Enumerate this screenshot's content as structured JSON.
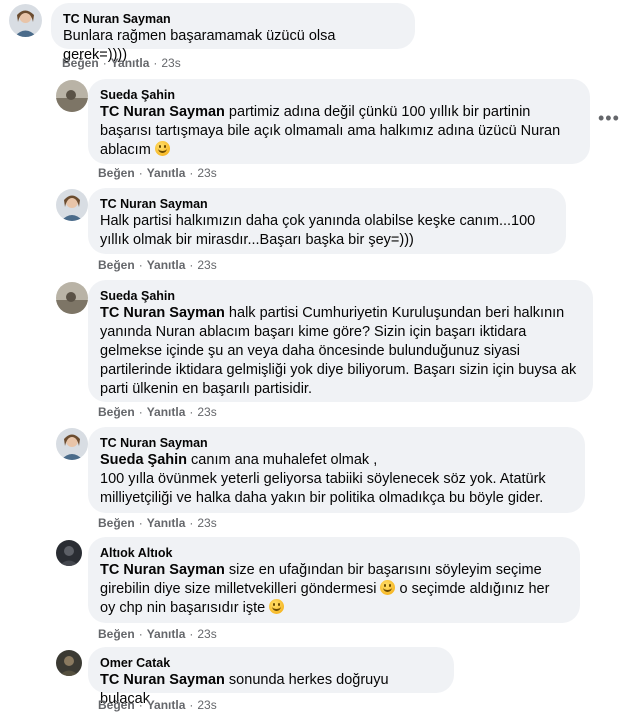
{
  "actions": {
    "like": "Beğen",
    "reply": "Yanıtla",
    "time": "23s",
    "sep": "·"
  },
  "comments": [
    {
      "author": "TC Nuran Sayman",
      "mention": "",
      "text": "Bunlara rağmen başaramamak üzücü olsa gerek=))))",
      "emoji": ""
    },
    {
      "author": "Sueda Şahin",
      "mention": "TC Nuran Sayman",
      "text": " partimiz adına değil çünkü 100 yıllık bir partinin başarısı tartışmaya bile açık olmamalı ama halkımız adına üzücü Nuran ablacım ",
      "emoji": "smile"
    },
    {
      "author": "TC Nuran Sayman",
      "mention": "",
      "text": "Halk partisi halkımızın daha çok yanında olabilse keşke canım...100 yıllık olmak bir mirasdır...Başarı başka bir şey=)))",
      "emoji": ""
    },
    {
      "author": "Sueda Şahin",
      "mention": "TC Nuran Sayman",
      "text": " halk partisi Cumhuriyetin Kuruluşundan beri halkının yanında Nuran ablacım başarı kime göre? Sizin için başarı iktidara gelmekse içinde şu an veya daha öncesinde bulunduğunuz siyasi partilerinde iktidara gelmişliği yok diye biliyorum. Başarı sizin için buysa ak parti ülkenin en başarılı partisidir.",
      "emoji": ""
    },
    {
      "author": "TC Nuran Sayman",
      "mention": "Sueda Şahin",
      "text": " canım ana muhalefet olmak ,",
      "text2": "100 yılla övünmek yeterli geliyorsa tabiiki söylenecek söz yok. Atatürk milliyetçiliği ve halka daha yakın bir politika olmadıkça bu böyle gider.",
      "emoji": ""
    },
    {
      "author": "Altıok Altıok",
      "mention": "TC Nuran Sayman",
      "text": " size en ufağından bir başarısını söyleyim seçime girebilin diye size milletvekilleri göndermesi ",
      "text2": " o seçimde aldığınız her oy chp nin başarısıdır işte ",
      "emoji": "grin"
    },
    {
      "author": "Omer Catak",
      "mention": "TC Nuran Sayman",
      "text": " sonunda herkes doğruyu bulacak",
      "emoji": ""
    }
  ],
  "colors": {
    "bubble": "#f0f2f5",
    "meta": "#65676b",
    "text": "#050505"
  },
  "icons": {
    "more": "more-options-icon",
    "smile": "smiling-face-icon",
    "grin": "grinning-face-icon"
  }
}
